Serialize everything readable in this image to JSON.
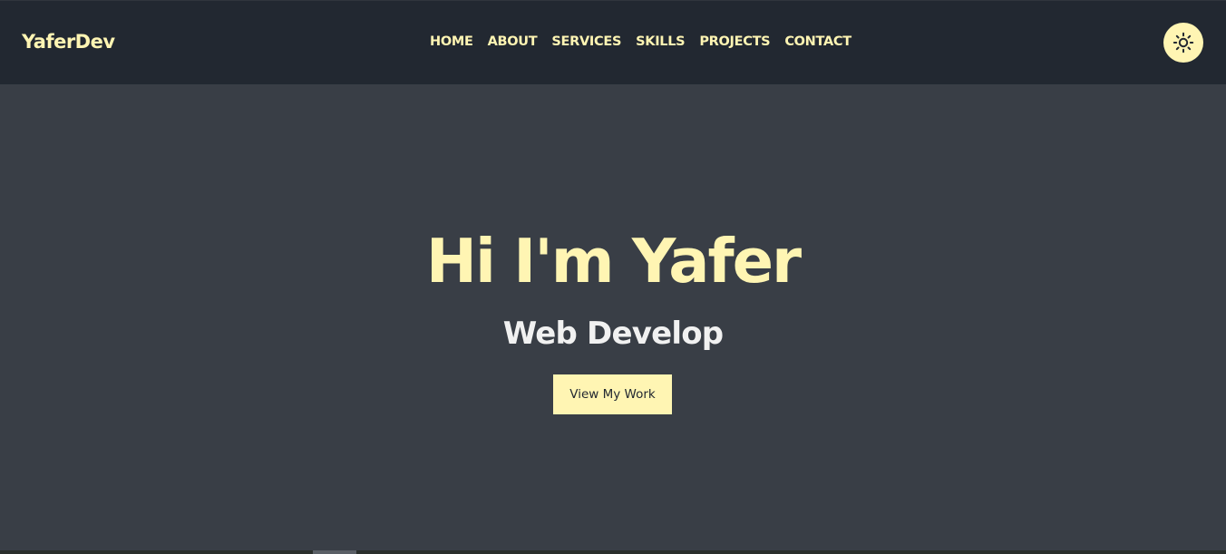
{
  "navbar": {
    "brand": "YaferDev",
    "links": [
      {
        "label": "HOME"
      },
      {
        "label": "ABOUT"
      },
      {
        "label": "SERVICES"
      },
      {
        "label": "SKILLS"
      },
      {
        "label": "PROJECTS"
      },
      {
        "label": "CONTACT"
      }
    ],
    "theme_toggle_icon": "sun-icon"
  },
  "hero": {
    "title": "Hi I'm Yafer",
    "subtitle": "Web Develop",
    "cta_label": "View My Work"
  },
  "colors": {
    "navbar_bg": "#222831",
    "page_bg": "#393e46",
    "accent": "#fff5b3",
    "subtitle_text": "#f1f1f1"
  }
}
